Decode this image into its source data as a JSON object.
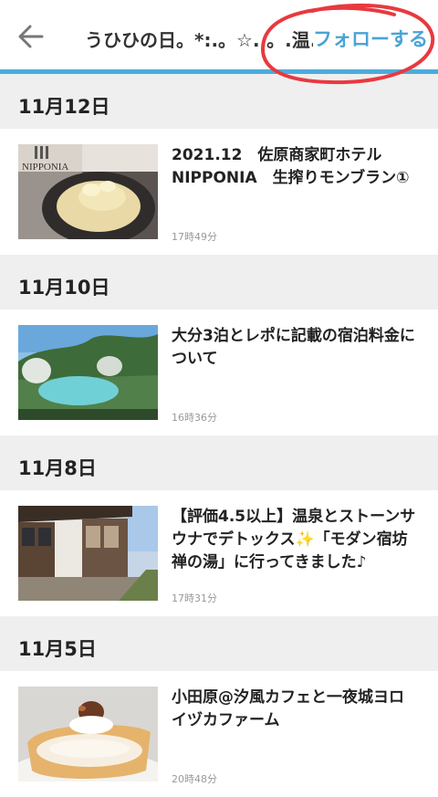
{
  "header": {
    "title": "うひひの日。*:.。☆..。.温...",
    "follow_label": "フォローする",
    "accent_color": "#4cabdc",
    "follow_color": "#4aa3d6",
    "back_icon": "arrow-left-icon"
  },
  "feed": [
    {
      "date": "11月12日",
      "articles": [
        {
          "title": "2021.12　佐原商家町ホテルNIPPONIA　生搾りモンブラン①",
          "time": "17時49分",
          "thumb_text": "NIPPONIA"
        }
      ]
    },
    {
      "date": "11月10日",
      "articles": [
        {
          "title": "大分3泊とレポに記載の宿泊料金について",
          "time": "16時36分"
        }
      ]
    },
    {
      "date": "11月8日",
      "articles": [
        {
          "title": "【評価4.5以上】温泉とストーンサウナでデトックス✨「モダン宿坊 禅の湯」に行ってきました♪",
          "time": "17時31分"
        }
      ]
    },
    {
      "date": "11月5日",
      "articles": [
        {
          "title": "小田原@汐風カフェと一夜城ヨロイヅカファーム",
          "time": "20時48分"
        }
      ]
    }
  ]
}
